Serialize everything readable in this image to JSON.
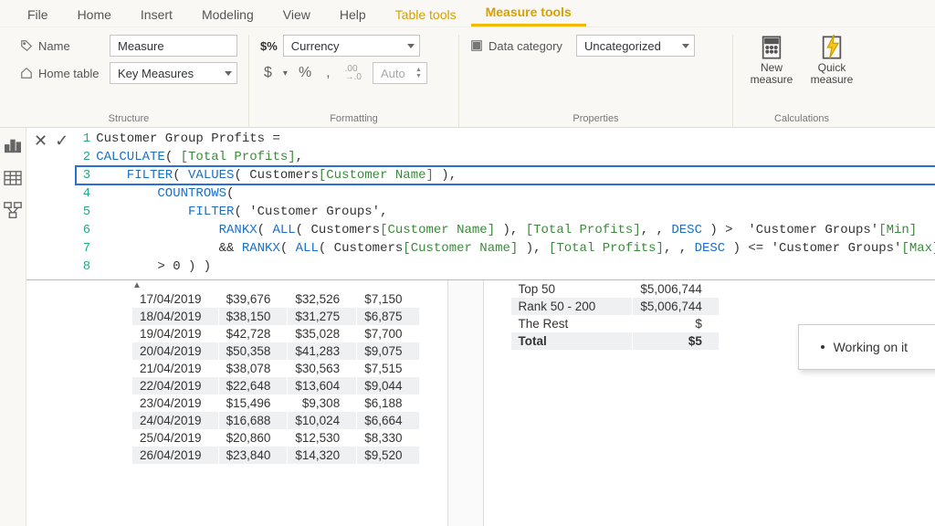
{
  "tabs": {
    "items": [
      "File",
      "Home",
      "Insert",
      "Modeling",
      "View",
      "Help",
      "Table tools",
      "Measure tools"
    ],
    "accent": [
      "Table tools",
      "Measure tools"
    ],
    "active": "Measure tools"
  },
  "structure": {
    "group_label": "Structure",
    "name_label": "Name",
    "name_value": "Measure",
    "home_table_label": "Home table",
    "home_table_value": "Key Measures"
  },
  "formatting": {
    "group_label": "Formatting",
    "format_prefix": "$%",
    "format_value": "Currency",
    "sym_dollar": "$",
    "sym_percent": "%",
    "sym_comma": ",",
    "sym_dec": ".00\n→.0",
    "auto_value": "Auto"
  },
  "properties": {
    "group_label": "Properties",
    "data_category_label": "Data category",
    "data_category_value": "Uncategorized"
  },
  "calc": {
    "group_label": "Calculations",
    "new_measure": "New\nmeasure",
    "quick_measure": "Quick\nmeasure"
  },
  "formula": {
    "lines": [
      "Customer Group Profits =",
      "CALCULATE( [Total Profits],",
      "    FILTER( VALUES( Customers[Customer Name] ),",
      "        COUNTROWS(",
      "            FILTER( 'Customer Groups',",
      "                RANKX( ALL( Customers[Customer Name] ), [Total Profits], , DESC ) >  'Customer Groups'[Min]",
      "                && RANKX( ALL( Customers[Customer Name] ), [Total Profits], , DESC ) <= 'Customer Groups'[Max] ) )",
      "        > 0 ) )"
    ]
  },
  "left_table": {
    "rows": [
      [
        "17/04/2019",
        "$39,676",
        "$32,526",
        "$7,150"
      ],
      [
        "18/04/2019",
        "$38,150",
        "$31,275",
        "$6,875"
      ],
      [
        "19/04/2019",
        "$42,728",
        "$35,028",
        "$7,700"
      ],
      [
        "20/04/2019",
        "$50,358",
        "$41,283",
        "$9,075"
      ],
      [
        "21/04/2019",
        "$38,078",
        "$30,563",
        "$7,515"
      ],
      [
        "22/04/2019",
        "$22,648",
        "$13,604",
        "$9,044"
      ],
      [
        "23/04/2019",
        "$15,496",
        "$9,308",
        "$6,188"
      ],
      [
        "24/04/2019",
        "$16,688",
        "$10,024",
        "$6,664"
      ],
      [
        "25/04/2019",
        "$20,860",
        "$12,530",
        "$8,330"
      ],
      [
        "26/04/2019",
        "$23,840",
        "$14,320",
        "$9,520"
      ]
    ]
  },
  "right_table": {
    "rows": [
      [
        "Top 50",
        "$5,006,744"
      ],
      [
        "Rank 50 - 200",
        "$5,006,744"
      ],
      [
        "The Rest",
        "$"
      ],
      [
        "Total",
        "$5"
      ]
    ]
  },
  "tooltip": {
    "text": "Working on it"
  }
}
